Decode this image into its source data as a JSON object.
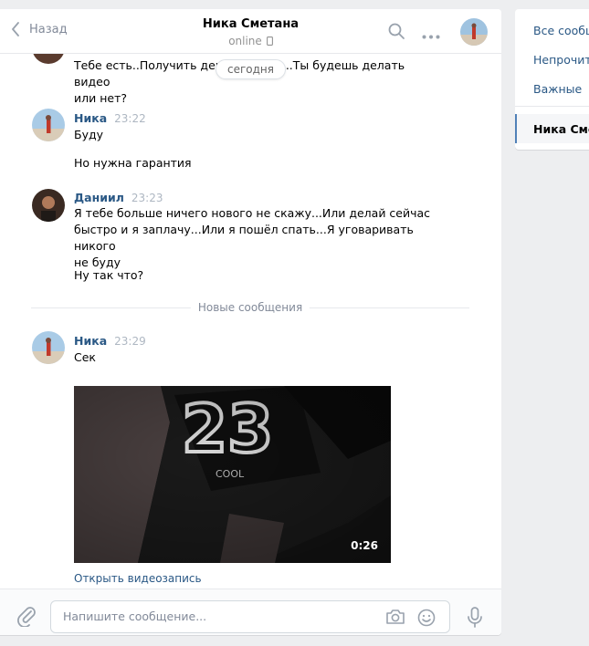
{
  "header": {
    "back_label": "Назад",
    "contact_name": "Ника Сметана",
    "status": "online"
  },
  "messages": {
    "partial_text_line1": "Тебе есть..Получить деньги и всё)...Ты будешь делать видео",
    "partial_text_line2": "или нет?",
    "day_label": "сегодня",
    "m1": {
      "author": "Ника",
      "time": "23:22",
      "text1": "Буду",
      "text2": "Но нужна гарантия"
    },
    "m2": {
      "author": "Даниил",
      "time": "23:23",
      "line1": "Я тебе больше ничего нового не скажу...Или делай сейчас",
      "line2": "быстро и я заплачу...Или я пошёл спать...Я уговаривать никого",
      "line3": "не буду",
      "text2": "Ну так что?"
    },
    "new_divider": "Новые сообщения",
    "m3": {
      "author": "Ника",
      "time": "23:29",
      "text": "Сек"
    },
    "video": {
      "duration": "0:26",
      "jersey_number": "23",
      "jersey_text": "COOL",
      "open_label": "Открыть видеозапись"
    }
  },
  "composer": {
    "placeholder": "Напишите сообщение..."
  },
  "right_panel": {
    "items": [
      "Все сообщения",
      "Непрочитанные",
      "Важные"
    ],
    "active_chat": "Ника Сметана"
  },
  "colors": {
    "link": "#2a5885",
    "accent": "#5181b8",
    "muted": "#828a99",
    "background": "#edeef0"
  }
}
